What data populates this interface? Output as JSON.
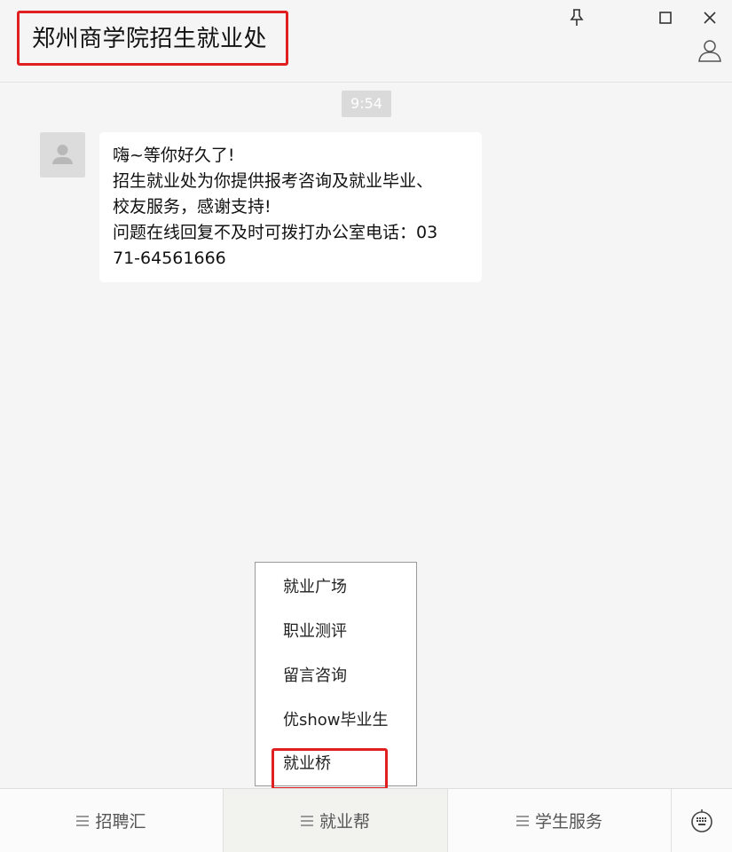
{
  "window": {
    "title": "郑州商学院招生就业处",
    "controls": [
      "pin-icon",
      "maximize-icon",
      "close-icon",
      "profile-icon"
    ]
  },
  "chat": {
    "timestamp": "9:54",
    "message": {
      "lines": [
        "嗨~等你好久了!",
        "招生就业处为你提供报考咨询及就业毕业、",
        "校友服务，感谢支持!",
        "问题在线回复不及时可拨打办公室电话：03",
        "71-64561666"
      ]
    }
  },
  "popup_menu": {
    "items": [
      "就业广场",
      "职业测评",
      "留言咨询",
      "优show毕业生",
      "就业桥"
    ]
  },
  "bottom_menu": {
    "tabs": [
      "招聘汇",
      "就业帮",
      "学生服务"
    ],
    "keyboard_icon": "keyboard-icon"
  },
  "colors": {
    "background": "#f5f5f5",
    "highlight": "#e02020",
    "timestamp_bg": "#dadada"
  }
}
